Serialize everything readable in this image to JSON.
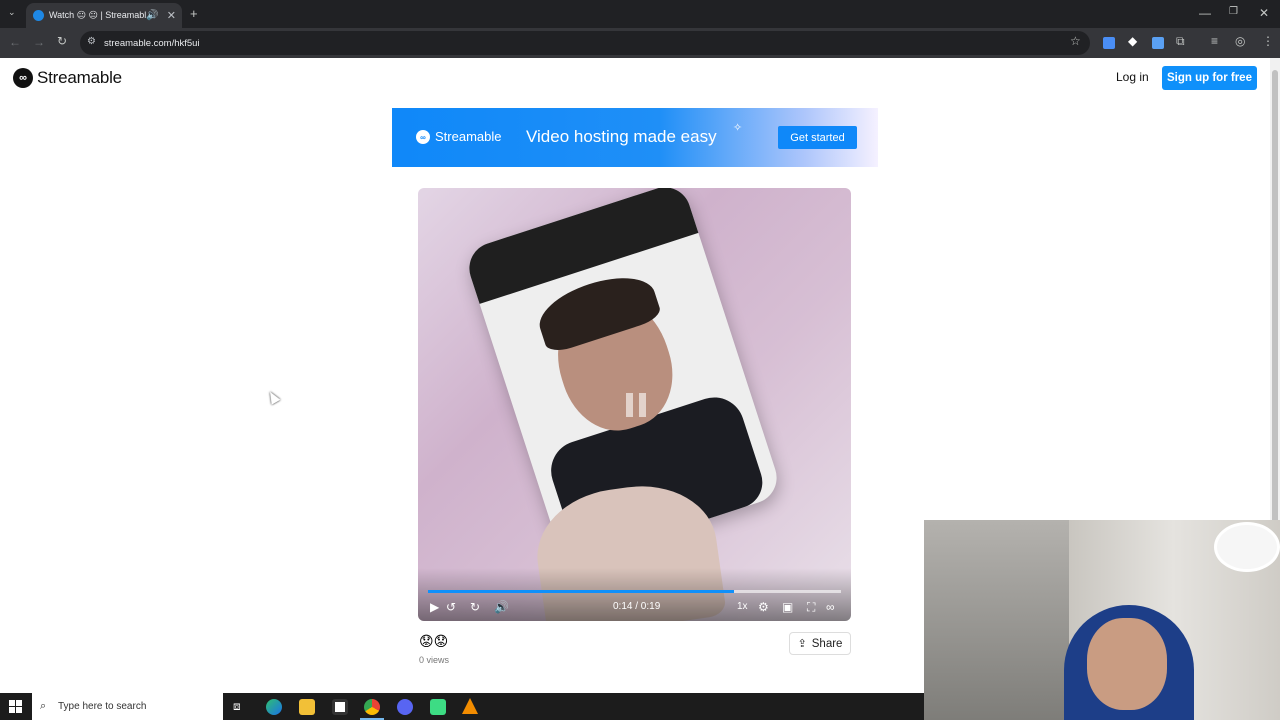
{
  "browser": {
    "tab_title": "Watch 😐 😐 | Streamable",
    "new_tab": "+",
    "url": "streamable.com/hkf5ui",
    "window_controls": [
      "minimize",
      "restore",
      "close"
    ]
  },
  "header": {
    "logo_text": "Streamable",
    "login_label": "Log in",
    "signup_label": "Sign up for free"
  },
  "banner": {
    "brand": "Streamable",
    "tagline": "Video hosting made easy",
    "cta_label": "Get started"
  },
  "video": {
    "time_display": "0:14 / 0:19",
    "progress": 0.74,
    "speed_label": "1x"
  },
  "reactions": "😟😟",
  "views": "0 views",
  "share_label": "Share",
  "taskbar": {
    "search_placeholder": "Type here to search"
  },
  "colors": {
    "accent": "#0f90fa",
    "chrome_dark": "#202124",
    "taskbar": "#1c1c1c"
  }
}
